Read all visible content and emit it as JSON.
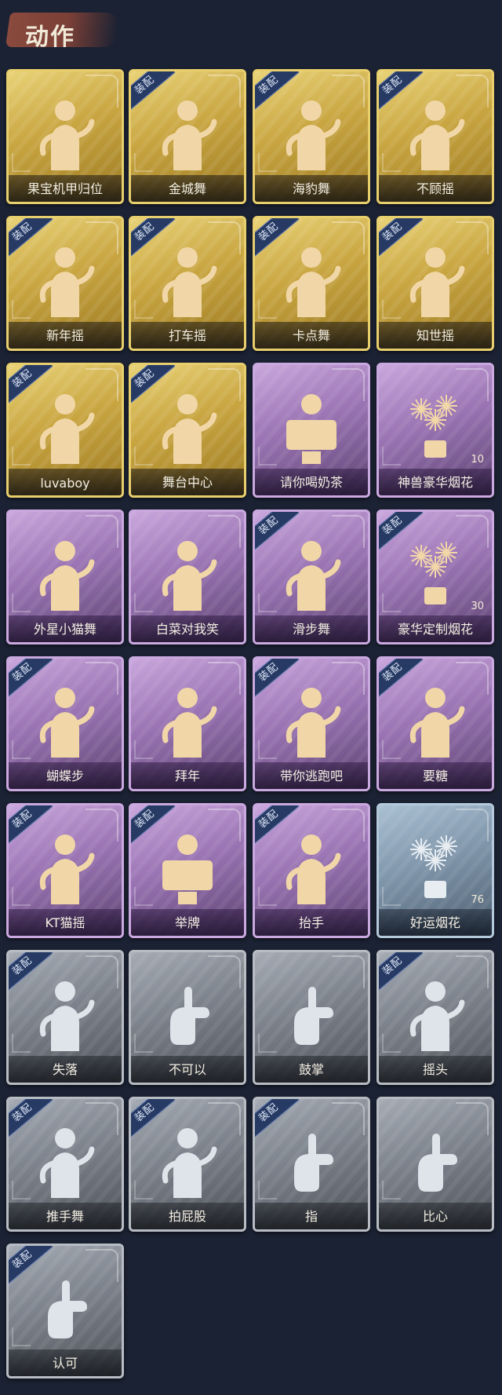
{
  "section_title": "动作",
  "equipped_badge": "装配",
  "cards": [
    {
      "label": "果宝机甲归位",
      "tier": "gold",
      "equipped": false,
      "icon": "pose-emote-icon"
    },
    {
      "label": "金城舞",
      "tier": "gold",
      "equipped": true,
      "icon": "dance-emote-icon"
    },
    {
      "label": "海豹舞",
      "tier": "gold",
      "equipped": true,
      "icon": "dance-emote-icon"
    },
    {
      "label": "不顾摇",
      "tier": "gold",
      "equipped": true,
      "icon": "dance-emote-icon"
    },
    {
      "label": "新年摇",
      "tier": "gold",
      "equipped": true,
      "icon": "dance-emote-icon"
    },
    {
      "label": "打车摇",
      "tier": "gold",
      "equipped": true,
      "icon": "dance-emote-icon"
    },
    {
      "label": "卡点舞",
      "tier": "gold",
      "equipped": true,
      "icon": "dance-emote-icon"
    },
    {
      "label": "知世摇",
      "tier": "gold",
      "equipped": true,
      "icon": "dance-emote-icon"
    },
    {
      "label": "luvaboy",
      "tier": "gold",
      "equipped": true,
      "icon": "dance-emote-icon"
    },
    {
      "label": "舞台中心",
      "tier": "gold",
      "equipped": true,
      "icon": "dance-emote-icon"
    },
    {
      "label": "请你喝奶茶",
      "tier": "purple",
      "equipped": false,
      "icon": "sign-emote-icon"
    },
    {
      "label": "神兽豪华烟花",
      "tier": "purple",
      "equipped": false,
      "icon": "fireworks-icon",
      "count": "10"
    },
    {
      "label": "外星小猫舞",
      "tier": "purple",
      "equipped": false,
      "icon": "dance-emote-icon"
    },
    {
      "label": "白菜对我笑",
      "tier": "purple",
      "equipped": false,
      "icon": "dance-emote-icon"
    },
    {
      "label": "滑步舞",
      "tier": "purple",
      "equipped": true,
      "icon": "dance-emote-icon"
    },
    {
      "label": "豪华定制烟花",
      "tier": "purple",
      "equipped": true,
      "icon": "fireworks-icon",
      "count": "30"
    },
    {
      "label": "蝴蝶步",
      "tier": "purple",
      "equipped": true,
      "icon": "dance-emote-icon"
    },
    {
      "label": "拜年",
      "tier": "purple",
      "equipped": false,
      "icon": "bow-emote-icon"
    },
    {
      "label": "带你逃跑吧",
      "tier": "purple",
      "equipped": true,
      "icon": "dance-emote-icon"
    },
    {
      "label": "要糖",
      "tier": "purple",
      "equipped": true,
      "icon": "beg-emote-icon"
    },
    {
      "label": "KT猫摇",
      "tier": "purple",
      "equipped": true,
      "icon": "dance-emote-icon"
    },
    {
      "label": "举牌",
      "tier": "purple",
      "equipped": true,
      "icon": "sign-emote-icon"
    },
    {
      "label": "抬手",
      "tier": "purple",
      "equipped": true,
      "icon": "wave-emote-icon"
    },
    {
      "label": "好运烟花",
      "tier": "blue",
      "equipped": false,
      "icon": "fireworks-icon",
      "count": "76"
    },
    {
      "label": "失落",
      "tier": "gray",
      "equipped": true,
      "icon": "crawl-emote-icon"
    },
    {
      "label": "不可以",
      "tier": "gray",
      "equipped": false,
      "icon": "finger-no-icon"
    },
    {
      "label": "鼓掌",
      "tier": "gray",
      "equipped": false,
      "icon": "clap-icon"
    },
    {
      "label": "摇头",
      "tier": "gray",
      "equipped": true,
      "icon": "shake-head-icon"
    },
    {
      "label": "推手舞",
      "tier": "gray",
      "equipped": true,
      "icon": "dance-emote-icon"
    },
    {
      "label": "拍屁股",
      "tier": "gray",
      "equipped": true,
      "icon": "dance-emote-icon"
    },
    {
      "label": "指",
      "tier": "gray",
      "equipped": true,
      "icon": "point-hand-icon"
    },
    {
      "label": "比心",
      "tier": "gray",
      "equipped": false,
      "icon": "heart-hand-icon"
    },
    {
      "label": "认可",
      "tier": "gray",
      "equipped": true,
      "icon": "thumbs-up-icon"
    }
  ]
}
